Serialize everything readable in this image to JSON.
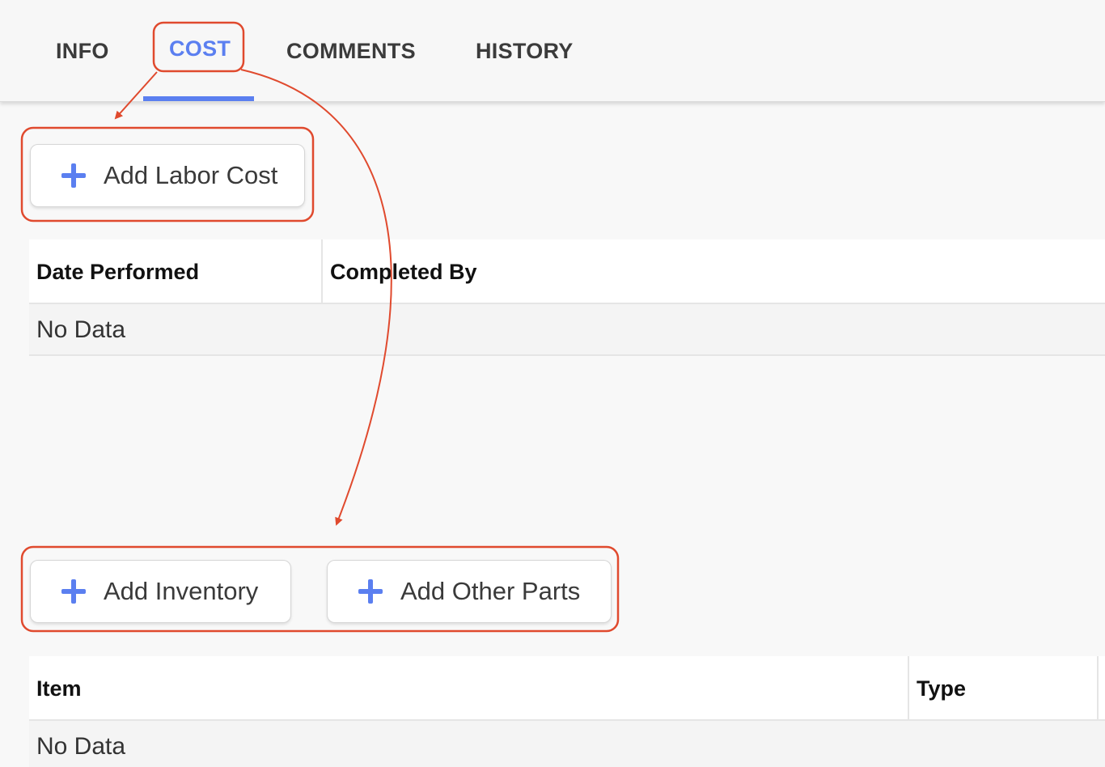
{
  "tabs": [
    {
      "label": "INFO",
      "active": false
    },
    {
      "label": "COST",
      "active": true
    },
    {
      "label": "COMMENTS",
      "active": false
    },
    {
      "label": "HISTORY",
      "active": false
    }
  ],
  "labor": {
    "add_button_label": "Add Labor Cost",
    "columns": [
      "Date Performed",
      "Completed By"
    ],
    "empty_text": "No Data"
  },
  "parts": {
    "add_inventory_label": "Add Inventory",
    "add_other_parts_label": "Add Other Parts",
    "columns": [
      "Item",
      "Type"
    ],
    "empty_text": "No Data"
  },
  "colors": {
    "accent": "#5b7ff0",
    "annotation": "#e04a2e",
    "text": "#3a3a3a"
  },
  "icons": [
    "plus-icon"
  ]
}
